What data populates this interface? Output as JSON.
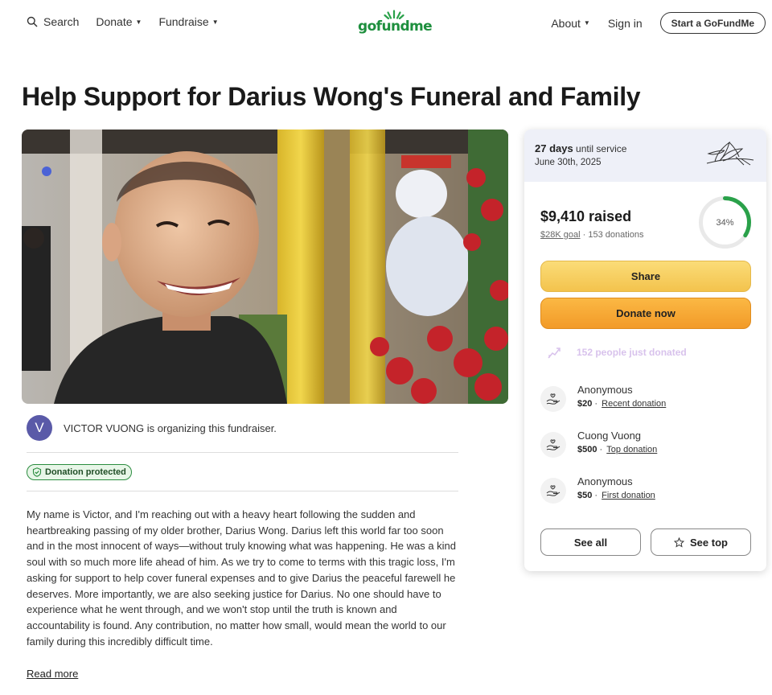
{
  "header": {
    "search_label": "Search",
    "donate_label": "Donate",
    "fundraise_label": "Fundraise",
    "logo_text": "gofundme",
    "about_label": "About",
    "signin_label": "Sign in",
    "start_label": "Start a GoFundMe"
  },
  "page_title": "Help Support for Darius Wong's Funeral and Family",
  "organizer": {
    "initial": "V",
    "text": "VICTOR VUONG is organizing this fundraiser."
  },
  "protected_label": "Donation protected",
  "story": "My name is Victor, and I'm reaching out with a heavy heart following the sudden and heartbreaking passing of my older brother, Darius Wong. Darius left this world far too soon and in the most innocent of ways—without truly knowing what was happening. He was a kind soul with so much more life ahead of him. As we try to come to terms with this tragic loss, I'm asking for support to help cover funeral expenses and to give Darius the peaceful farewell he deserves. More importantly, we are also seeking justice for Darius. No one should have to experience what he went through, and we won't stop until the truth is known and accountability is found. Any contribution, no matter how small, would mean the world to our family during this incredibly difficult time.",
  "read_more": "Read more",
  "card": {
    "days_count": "27 days",
    "days_suffix": "until service",
    "service_date": "June 30th, 2025",
    "raised": "$9,410 raised",
    "goal": "$28K goal",
    "separator": "·",
    "donation_count": "153 donations",
    "percent_label": "34%",
    "progress_fraction": 0.34,
    "share_label": "Share",
    "donate_label": "Donate now",
    "just_donated": "152 people just donated",
    "donations": [
      {
        "name": "Anonymous",
        "amount": "$20",
        "sep": "·",
        "tag": "Recent donation"
      },
      {
        "name": "Cuong Vuong",
        "amount": "$500",
        "sep": "·",
        "tag": "Top donation"
      },
      {
        "name": "Anonymous",
        "amount": "$50",
        "sep": "·",
        "tag": "First donation"
      }
    ],
    "see_all_label": "See all",
    "see_top_label": "See top"
  },
  "colors": {
    "brand_green": "#1e8f3e",
    "progress_green": "#2aa14a",
    "share_yellow": "#f6cc5a",
    "donate_orange": "#f5a230",
    "badge_bg": "#e8f6e8"
  }
}
